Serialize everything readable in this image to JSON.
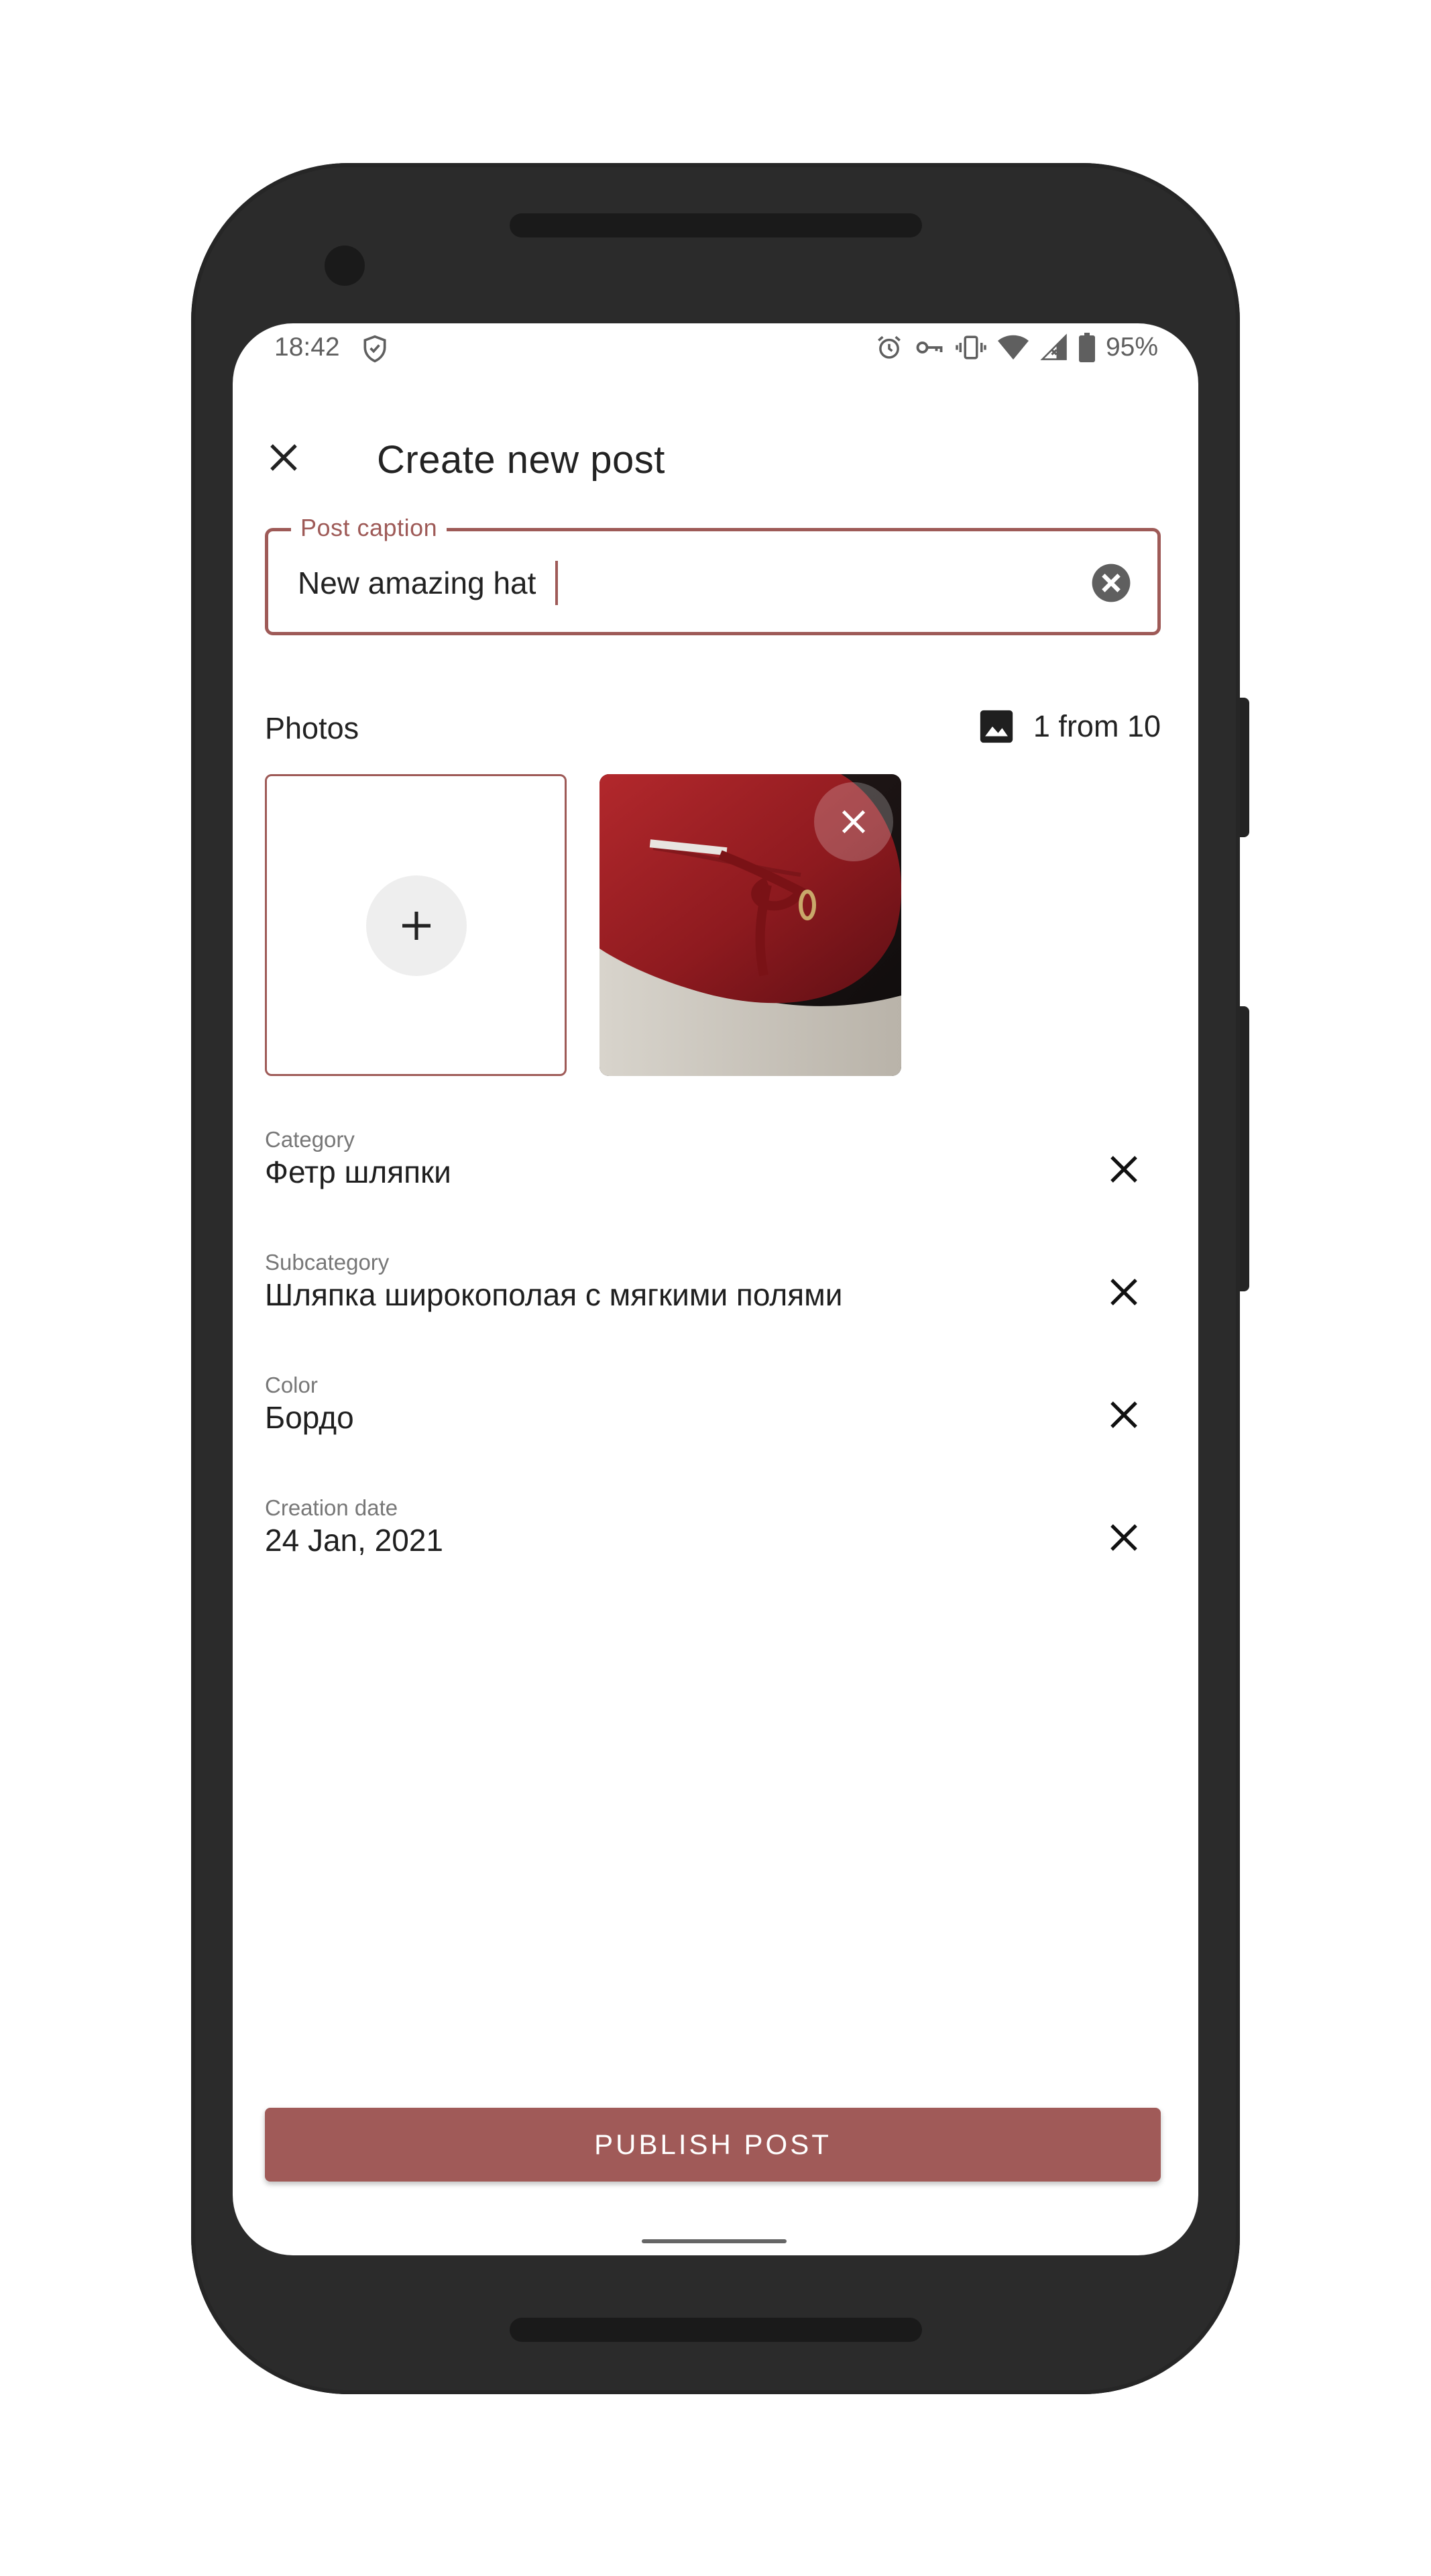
{
  "status_bar": {
    "time": "18:42",
    "battery": "95%"
  },
  "app_bar": {
    "title": "Create new post",
    "close_icon": "close-icon"
  },
  "caption_field": {
    "label": "Post caption",
    "value": "New amazing hat",
    "clear_icon": "cancel-circle-icon"
  },
  "photos": {
    "label": "Photos",
    "counter": "1 from 10",
    "count_icon": "image-icon",
    "add_icon": "plus-icon",
    "remove_icon": "close-icon"
  },
  "attributes": [
    {
      "label": "Category",
      "value": "Фетр шляпки"
    },
    {
      "label": "Subcategory",
      "value": "Шляпка широкополая с мягкими полями"
    },
    {
      "label": "Color",
      "value": "Бордо"
    },
    {
      "label": "Creation date",
      "value": "24 Jan, 2021"
    }
  ],
  "publish_button": {
    "label": "PUBLISH POST"
  },
  "colors": {
    "accent": "#9e5a57",
    "button": "#a05a58",
    "frame": "#2b2b2b"
  }
}
